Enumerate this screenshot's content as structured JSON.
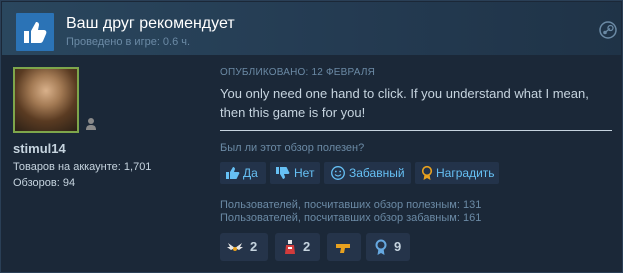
{
  "header": {
    "title": "Ваш друг рекомендует",
    "playtime": "Проведено в игре: 0.6 ч."
  },
  "author": {
    "username": "stimul14",
    "products": "Товаров на аккаунте: 1,701",
    "reviews": "Обзоров: 94"
  },
  "review": {
    "posted": "ОПУБЛИКОВАНО: 12 ФЕВРАЛЯ",
    "text": "You only need one hand to click. If you understand what I mean, then this game is for you!",
    "helpful_question": "Был ли этот обзор полезен?"
  },
  "buttons": {
    "yes": "Да",
    "no": "Нет",
    "funny": "Забавный",
    "award": "Наградить"
  },
  "votes": {
    "helpful": "Пользователей, посчитавших обзор полезным: 131",
    "funny": "Пользователей, посчитавших обзор забавным: 161"
  },
  "awards": [
    {
      "icon": "wings-award-icon",
      "count": "2"
    },
    {
      "icon": "potion-award-icon",
      "count": "2"
    },
    {
      "icon": "pistol-award-icon",
      "count": ""
    },
    {
      "icon": "medal-award-icon",
      "count": "9"
    }
  ],
  "colors": {
    "background": "#1b2838",
    "accent": "#66c0f4",
    "thumb": "#2b73b6",
    "award_gold": "#e8a11f"
  }
}
